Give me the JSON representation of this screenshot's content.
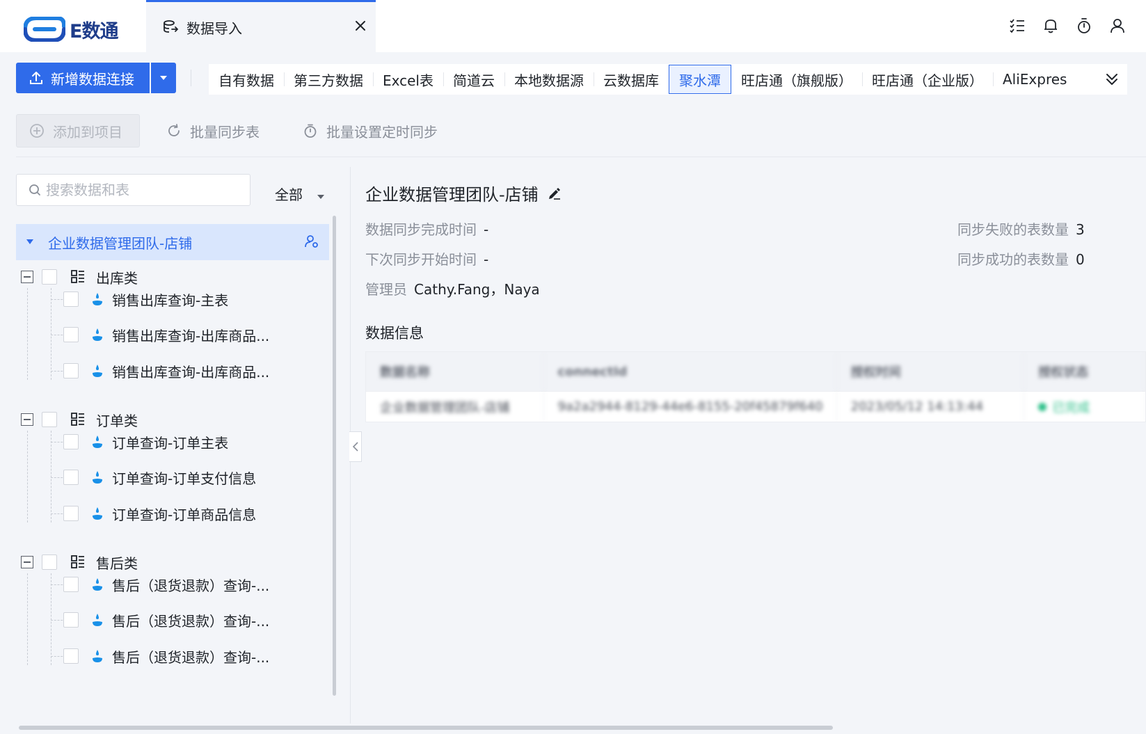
{
  "app": {
    "name": "E数通"
  },
  "tab": {
    "label": "数据导入"
  },
  "topbar_icons": [
    "task-list-icon",
    "bell-icon",
    "timer-icon",
    "user-icon"
  ],
  "toolbar": {
    "new_connection_label": "新增数据连接"
  },
  "source_tabs": {
    "items": [
      "自有数据",
      "第三方数据",
      "Excel表",
      "简道云",
      "本地数据源",
      "云数据库",
      "聚水潭",
      "旺店通（旗舰版）",
      "旺店通（企业版）",
      "AliExpres"
    ],
    "active": "聚水潭"
  },
  "actions": {
    "add_to_project": "添加到项目",
    "batch_sync": "批量同步表",
    "batch_schedule": "批量设置定时同步"
  },
  "search": {
    "placeholder": "搜索数据和表"
  },
  "filter": {
    "label": "全部"
  },
  "tree": {
    "root": "企业数据管理团队-店铺",
    "groups": [
      {
        "label": "出库类",
        "items": [
          "销售出库查询-主表",
          "销售出库查询-出库商品...",
          "销售出库查询-出库商品..."
        ]
      },
      {
        "label": "订单类",
        "items": [
          "订单查询-订单主表",
          "订单查询-订单支付信息",
          "订单查询-订单商品信息"
        ]
      },
      {
        "label": "售后类",
        "items": [
          "售后（退货退款）查询-...",
          "售后（退货退款）查询-...",
          "售后（退货退款）查询-..."
        ]
      }
    ]
  },
  "detail": {
    "title": "企业数据管理团队-店铺",
    "sync_done_label": "数据同步完成时间",
    "sync_done_value": "-",
    "next_sync_label": "下次同步开始时间",
    "next_sync_value": "-",
    "admin_label": "管理员",
    "admin_value": "Cathy.Fang，Naya",
    "failed_label": "同步失败的表数量",
    "failed_value": "3",
    "success_label": "同步成功的表数量",
    "success_value": "0",
    "section_title": "数据信息"
  },
  "data_table": {
    "headers": [
      "数据名称",
      "connectId",
      "授权时间",
      "授权状态"
    ],
    "row": [
      "企业数据管理团队-店铺",
      "9a2a2944-8129-44e6-8155-20f45879f640",
      "2023/05/12 14:13:44",
      "已完成"
    ]
  },
  "colors": {
    "primary": "#2f6bea",
    "status_ok": "#2bbf88"
  }
}
